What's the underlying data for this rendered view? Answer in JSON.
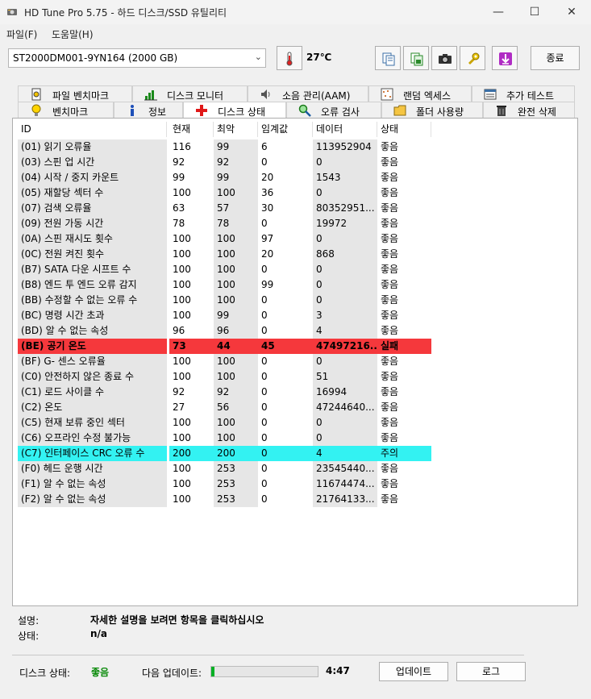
{
  "window": {
    "title": "HD Tune Pro 5.75 - 하드 디스크/SSD 유틸리티",
    "minimize": "—",
    "maximize": "☐",
    "close": "✕"
  },
  "menu": {
    "file": "파일(F)",
    "help": "도움말(H)"
  },
  "toolbar": {
    "drive": "ST2000DM001-9YN164 (2000 GB)",
    "temperature": "27℃",
    "exit_label": "종료"
  },
  "tabs_top": [
    {
      "label": "파일 벤치마크",
      "icon": "file-benchmark-icon"
    },
    {
      "label": "디스크 모니터",
      "icon": "disk-monitor-icon"
    },
    {
      "label": "소음 관리(AAM)",
      "icon": "speaker-icon"
    },
    {
      "label": "랜덤 엑세스",
      "icon": "random-access-icon"
    },
    {
      "label": "추가 테스트",
      "icon": "extra-tests-icon"
    }
  ],
  "tabs_bottom": [
    {
      "label": "벤치마크",
      "icon": "lightbulb-icon"
    },
    {
      "label": "정보",
      "icon": "info-icon"
    },
    {
      "label": "디스크 상태",
      "icon": "health-cross-icon"
    },
    {
      "label": "오류 검사",
      "icon": "magnifier-icon"
    },
    {
      "label": "폴더 사용량",
      "icon": "folder-icon"
    },
    {
      "label": "완전 삭제",
      "icon": "trash-icon"
    }
  ],
  "active_tab": "디스크 상태",
  "table": {
    "columns": [
      "ID",
      "현재",
      "최악",
      "임계값",
      "데이터",
      "상태"
    ],
    "rows": [
      {
        "id": "(01) 읽기 오류율",
        "current": "116",
        "worst": "99",
        "threshold": "6",
        "data": "113952904",
        "status": "좋음"
      },
      {
        "id": "(03) 스핀 업 시간",
        "current": "92",
        "worst": "92",
        "threshold": "0",
        "data": "0",
        "status": "좋음"
      },
      {
        "id": "(04) 시작 / 중지 카운트",
        "current": "99",
        "worst": "99",
        "threshold": "20",
        "data": "1543",
        "status": "좋음"
      },
      {
        "id": "(05) 재할당 섹터 수",
        "current": "100",
        "worst": "100",
        "threshold": "36",
        "data": "0",
        "status": "좋음"
      },
      {
        "id": "(07) 검색 오류율",
        "current": "63",
        "worst": "57",
        "threshold": "30",
        "data": "80352951...",
        "status": "좋음"
      },
      {
        "id": "(09) 전원 가동 시간",
        "current": "78",
        "worst": "78",
        "threshold": "0",
        "data": "19972",
        "status": "좋음"
      },
      {
        "id": "(0A) 스핀 재시도 횟수",
        "current": "100",
        "worst": "100",
        "threshold": "97",
        "data": "0",
        "status": "좋음"
      },
      {
        "id": "(0C) 전원 켜진 횟수",
        "current": "100",
        "worst": "100",
        "threshold": "20",
        "data": "868",
        "status": "좋음"
      },
      {
        "id": "(B7) SATA 다운 시프트 수",
        "current": "100",
        "worst": "100",
        "threshold": "0",
        "data": "0",
        "status": "좋음"
      },
      {
        "id": "(B8) 엔드 투 엔드 오류 감지",
        "current": "100",
        "worst": "100",
        "threshold": "99",
        "data": "0",
        "status": "좋음"
      },
      {
        "id": "(BB) 수정할 수 없는 오류 수",
        "current": "100",
        "worst": "100",
        "threshold": "0",
        "data": "0",
        "status": "좋음"
      },
      {
        "id": "(BC) 명령 시간 초과",
        "current": "100",
        "worst": "99",
        "threshold": "0",
        "data": "3",
        "status": "좋음"
      },
      {
        "id": "(BD) 알 수 없는 속성",
        "current": "96",
        "worst": "96",
        "threshold": "0",
        "data": "4",
        "status": "좋음"
      },
      {
        "id": "(BE) 공기 온도",
        "current": "73",
        "worst": "44",
        "threshold": "45",
        "data": "47497216...",
        "status": "실패",
        "state": "fail"
      },
      {
        "id": "(BF) G- 센스 오류율",
        "current": "100",
        "worst": "100",
        "threshold": "0",
        "data": "0",
        "status": "좋음"
      },
      {
        "id": "(C0) 안전하지 않은 종료 수",
        "current": "100",
        "worst": "100",
        "threshold": "0",
        "data": "51",
        "status": "좋음"
      },
      {
        "id": "(C1) 로드 사이클 수",
        "current": "92",
        "worst": "92",
        "threshold": "0",
        "data": "16994",
        "status": "좋음"
      },
      {
        "id": "(C2) 온도",
        "current": "27",
        "worst": "56",
        "threshold": "0",
        "data": "47244640...",
        "status": "좋음"
      },
      {
        "id": "(C5) 현재 보류 중인 섹터",
        "current": "100",
        "worst": "100",
        "threshold": "0",
        "data": "0",
        "status": "좋음"
      },
      {
        "id": "(C6) 오프라인 수정 불가능",
        "current": "100",
        "worst": "100",
        "threshold": "0",
        "data": "0",
        "status": "좋음"
      },
      {
        "id": "(C7) 인터페이스 CRC 오류 수",
        "current": "200",
        "worst": "200",
        "threshold": "0",
        "data": "4",
        "status": "주의",
        "state": "warn"
      },
      {
        "id": "(F0) 헤드 운행 시간",
        "current": "100",
        "worst": "253",
        "threshold": "0",
        "data": "23545440...",
        "status": "좋음"
      },
      {
        "id": "(F1) 알 수 없는 속성",
        "current": "100",
        "worst": "253",
        "threshold": "0",
        "data": "11674474...",
        "status": "좋음"
      },
      {
        "id": "(F2) 알 수 없는 속성",
        "current": "100",
        "worst": "253",
        "threshold": "0",
        "data": "21764133...",
        "status": "좋음"
      }
    ]
  },
  "details": {
    "desc_label": "설명:",
    "desc_value": "자세한 설명을 보려면 항목을 클릭하십시오",
    "status_label": "상태:",
    "status_value": "n/a"
  },
  "footer": {
    "disk_status_label": "디스크 상태:",
    "disk_status_value": "좋음",
    "next_update_label": "다음 업데이트:",
    "progress_fraction": 0.03,
    "time_left": "4:47",
    "update_button": "업데이트",
    "log_button": "로그"
  },
  "colors": {
    "fail_row": "#f5383c",
    "warn_row": "#33f2f2",
    "good_status": "#0a8a0a",
    "progress": "#06b025"
  }
}
